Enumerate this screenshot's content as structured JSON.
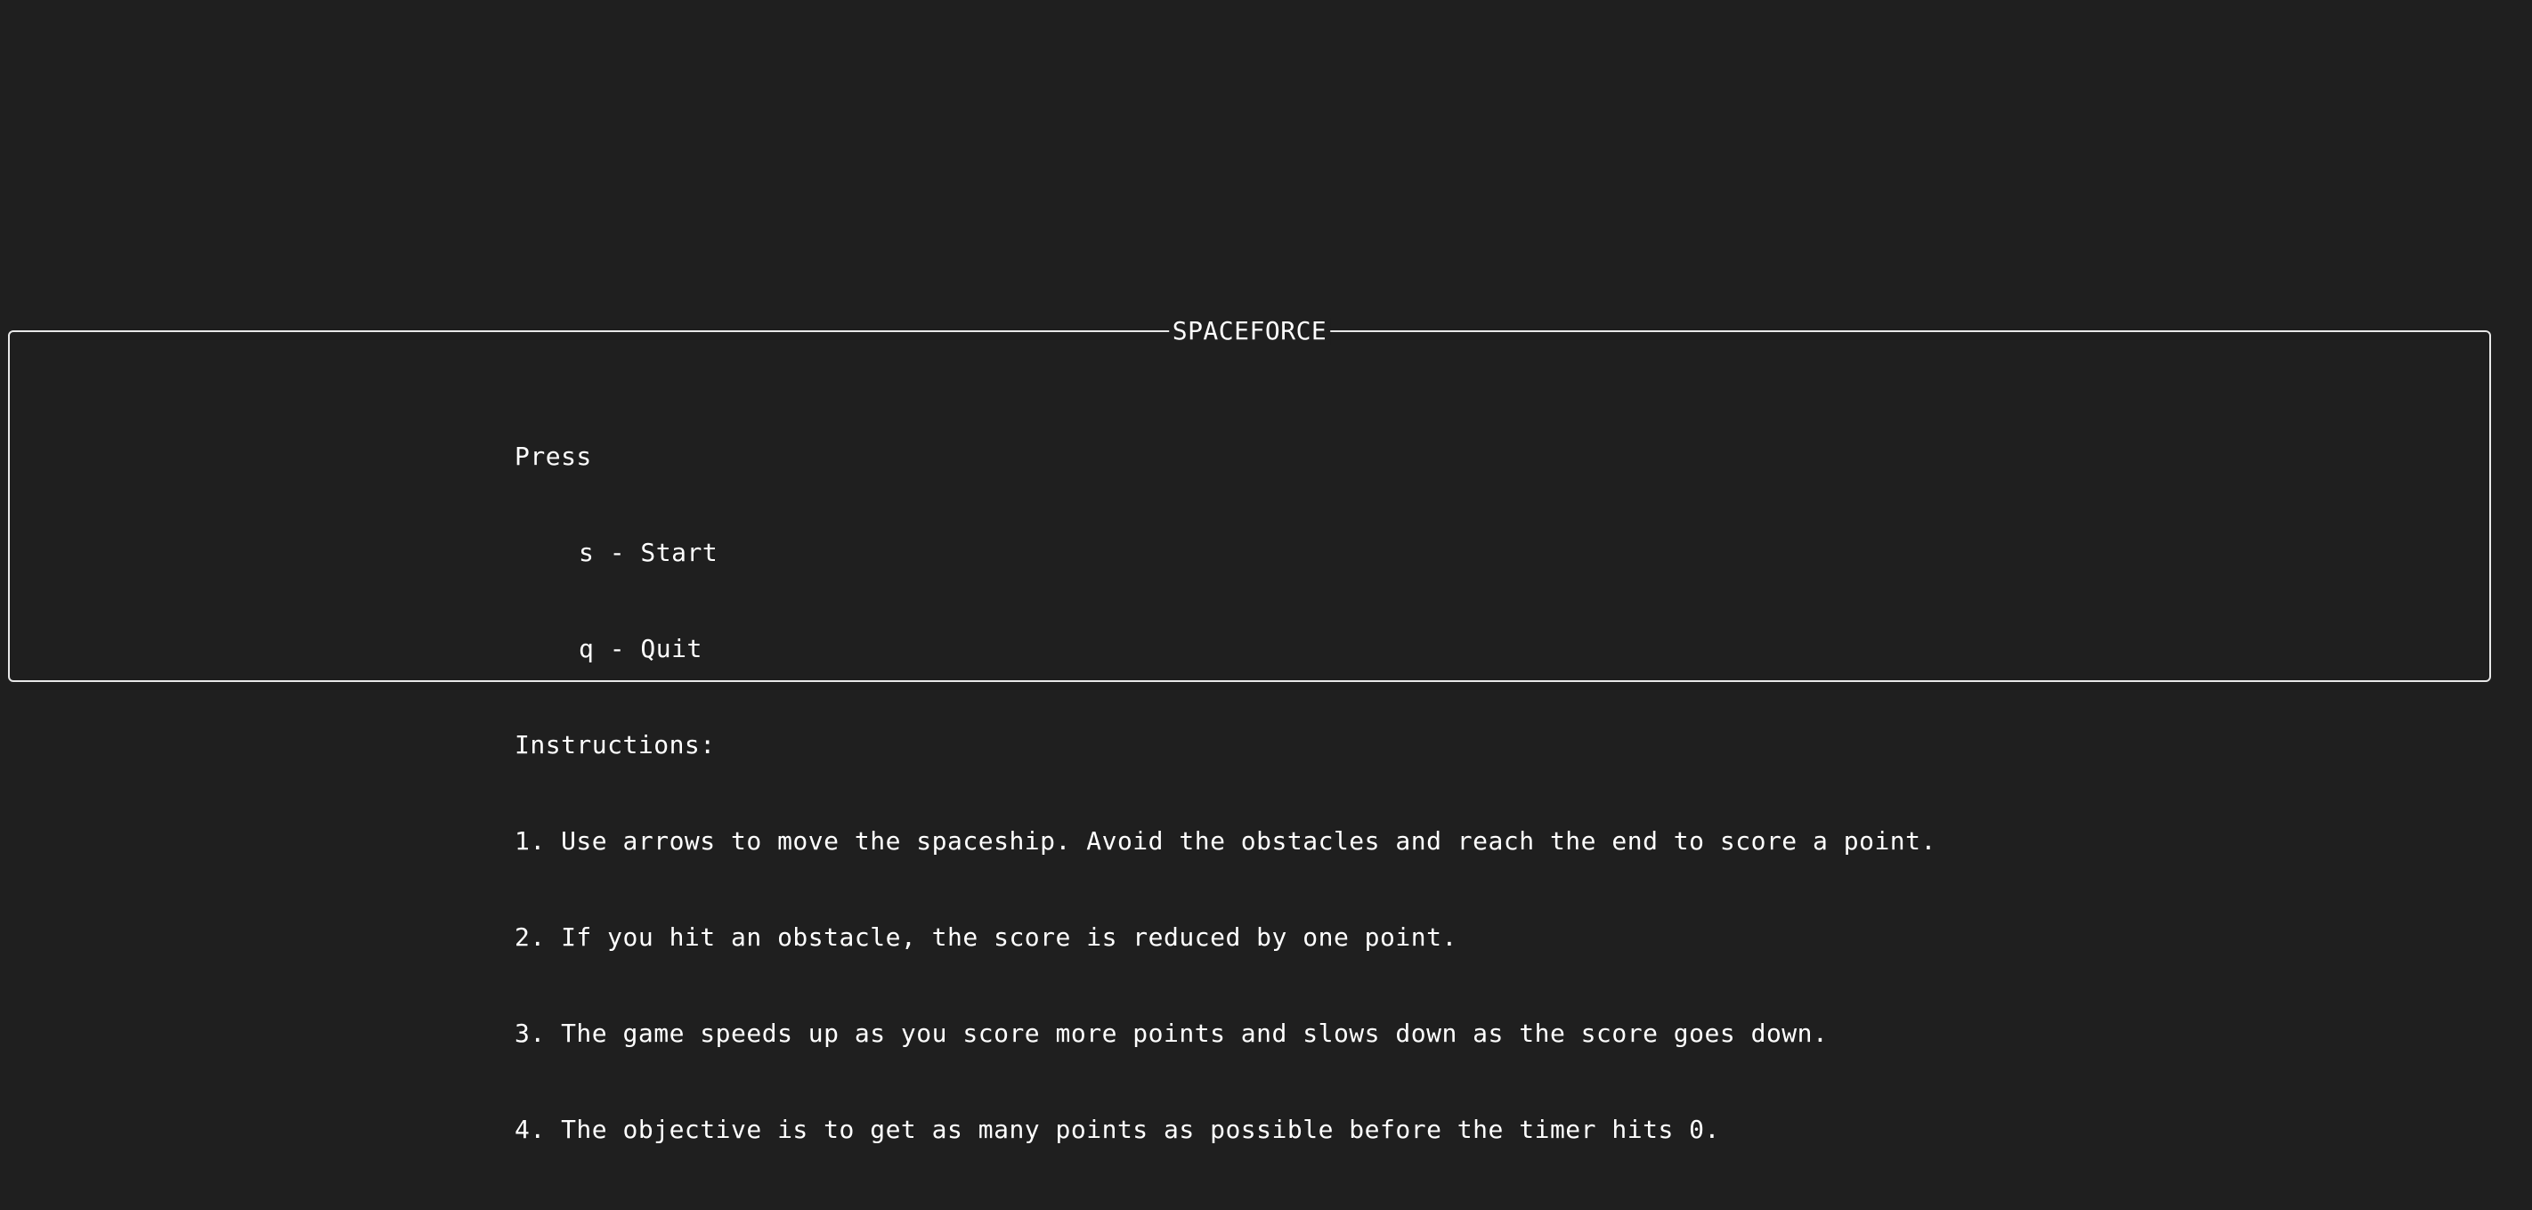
{
  "window": {
    "title": "SPACEFORCE"
  },
  "menu": {
    "press_label": "Press",
    "options": [
      {
        "key": "s",
        "label": "s - Start"
      },
      {
        "key": "q",
        "label": "q - Quit"
      }
    ]
  },
  "instructions": {
    "heading": "Instructions:",
    "items": [
      "1. Use arrows to move the spaceship. Avoid the obstacles and reach the end to score a point.",
      "2. If you hit an obstacle, the score is reduced by one point.",
      "3. The game speeds up as you score more points and slows down as the score goes down.",
      "4. The objective is to get as many points as possible before the timer hits 0."
    ]
  },
  "colors": {
    "background": "#1f1f1f",
    "foreground": "#ffffff",
    "border": "#e8e8e8"
  }
}
